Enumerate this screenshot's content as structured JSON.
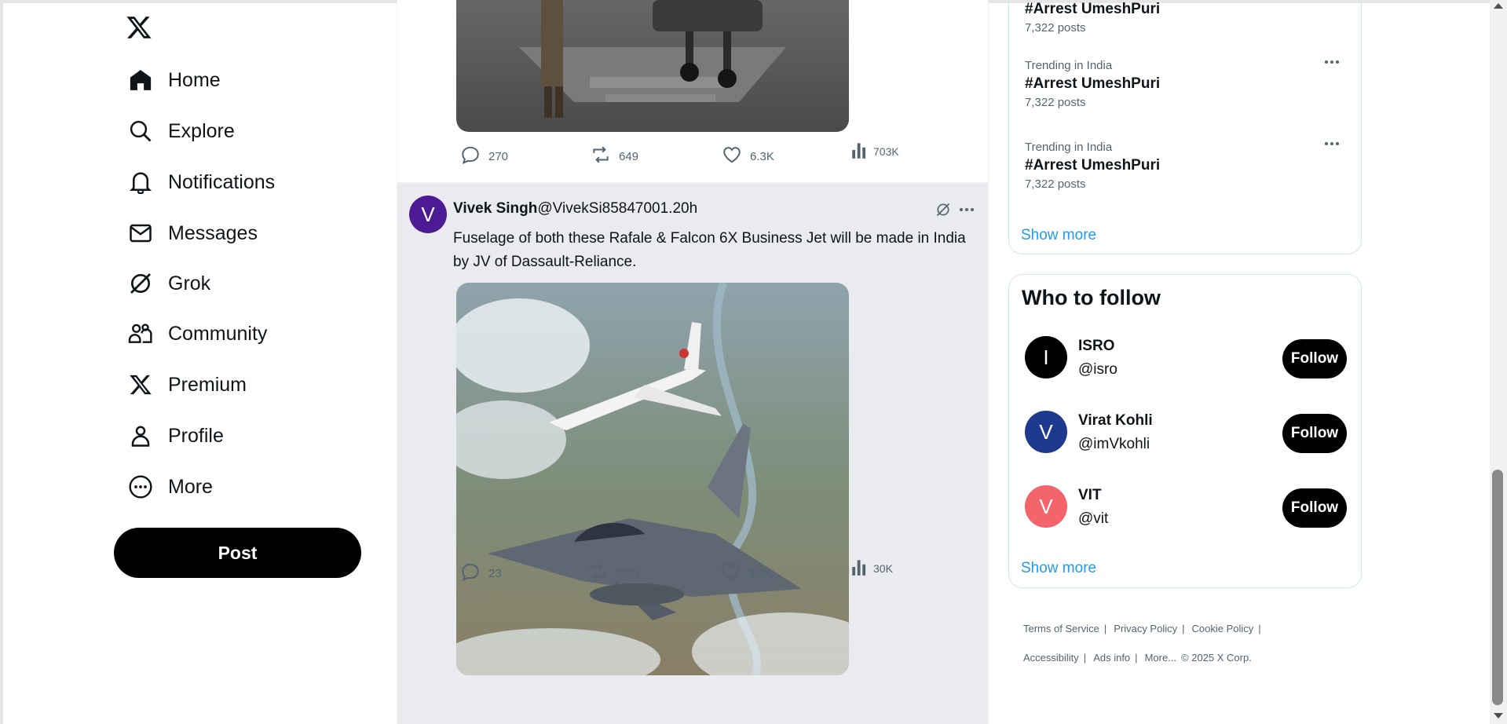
{
  "nav": {
    "items": [
      {
        "label": "Home",
        "icon": "home-icon"
      },
      {
        "label": "Explore",
        "icon": "search-icon"
      },
      {
        "label": "Notifications",
        "icon": "bell-icon"
      },
      {
        "label": "Messages",
        "icon": "envelope-icon"
      },
      {
        "label": "Grok",
        "icon": "grok-icon"
      },
      {
        "label": "Community",
        "icon": "community-icon"
      },
      {
        "label": "Premium",
        "icon": "x-logo-icon"
      },
      {
        "label": "Profile",
        "icon": "person-icon"
      },
      {
        "label": "More",
        "icon": "more-circle-icon"
      }
    ],
    "post_label": "Post"
  },
  "feed": {
    "previous_tweet": {
      "reply_count": "270",
      "repost_count": "649",
      "like_count": "6.3K",
      "view_count": "703K"
    },
    "tweet": {
      "avatar_letter": "V",
      "avatar_color": "#4d1a96",
      "name": "Vivek Singh",
      "handle_time": "@VivekSi85847001.20h",
      "text": "Fuselage of both these Rafale & Falcon 6X Business Jet will be made in India by JV of Dassault-Reliance.",
      "reply_count": "23",
      "repost_count": "292k",
      "like_count": "3.3K",
      "view_count": "30K"
    }
  },
  "trends": {
    "items": [
      {
        "meta": "",
        "tag": "#Arrest UmeshPuri",
        "posts": "7,322 posts"
      },
      {
        "meta": "Trending in India",
        "tag": "#Arrest UmeshPuri",
        "posts": "7,322 posts"
      },
      {
        "meta": "Trending in India",
        "tag": "#Arrest UmeshPuri",
        "posts": "7,322 posts"
      }
    ],
    "show_more": "Show more"
  },
  "who_to_follow": {
    "title": "Who to follow",
    "accounts": [
      {
        "avatar_letter": "I",
        "avatar_color": "#000000",
        "name": "ISRO",
        "handle": "@isro",
        "follow_label": "Follow"
      },
      {
        "avatar_letter": "V",
        "avatar_color": "#1d3a8f",
        "name": "Virat Kohli",
        "handle": "@imVkohli",
        "follow_label": "Follow"
      },
      {
        "avatar_letter": "V",
        "avatar_color": "#f4646b",
        "name": "VIT",
        "handle": "@vit",
        "follow_label": "Follow"
      }
    ],
    "show_more": "Show more"
  },
  "footer": {
    "terms": "Terms of Service",
    "privacy": "Privacy Policy",
    "cookie": "Cookie Policy",
    "accessibility": "Accessibility",
    "ads_info": "Ads info",
    "more": "More...",
    "copyright": "© 2025 X Corp.",
    "separator": "|"
  },
  "colors": {
    "accent": "#1d9bf0",
    "selected_tweet_bg": "#e9ebee"
  }
}
